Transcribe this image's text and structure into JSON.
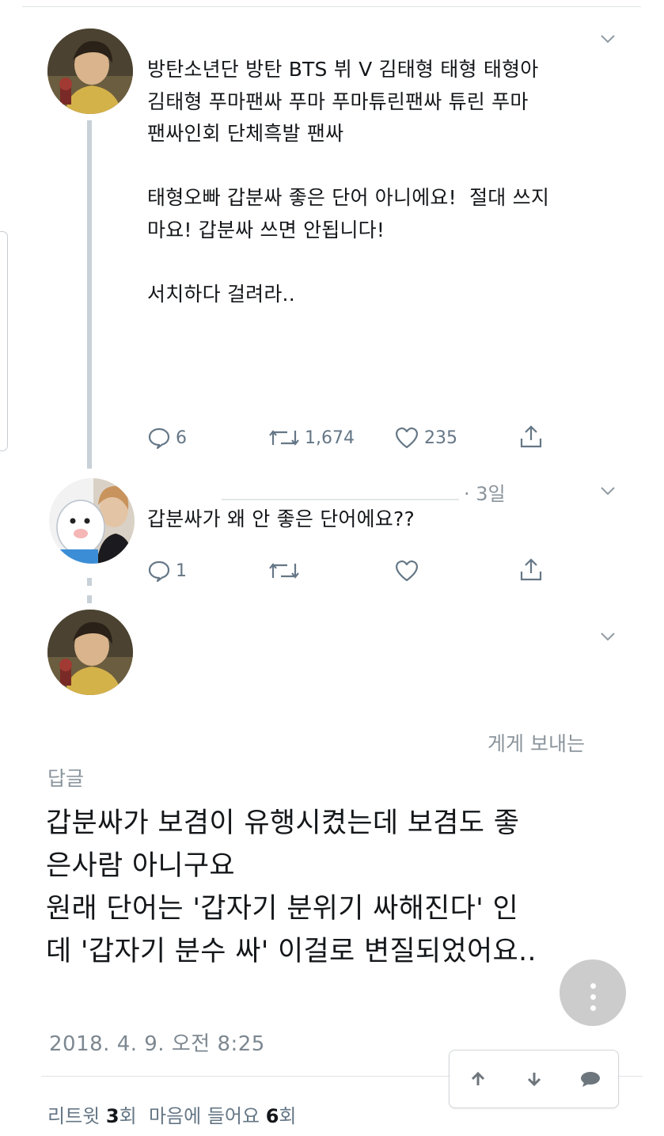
{
  "tweet1": {
    "text": "방탄소년단 방탄 BTS 뷔 V 김태형 태형 태형아\n김태형 푸마팬싸 푸마 푸마튜린팬싸 튜린 푸마\n팬싸인회 단체흑발 팬싸\n\n태형오빠 갑분싸 좋은 단어 아니에요!  절대 쓰지\n마요! 갑분싸 쓰면 안됩니다!\n\n서치하다 걸려라..",
    "replies": "6",
    "retweets": "1,674",
    "likes": "235"
  },
  "tweet2": {
    "time": "· 3일",
    "text": "갑분싸가 왜 안 좋은 단어에요??",
    "replies": "1"
  },
  "tweet3": {
    "partial_line": "게게 보내는",
    "reply_label": "답글",
    "text_lines": [
      "갑분싸가 보겸이 유행시켰는데 보겸도 좋",
      "은사람 아니구요",
      "원래 단어는 '갑자기 분위기 싸해진다' 인",
      "데 '갑자기 분수 싸' 이걸로 변질되었어요.."
    ],
    "date": "2018. 4. 9. 오전 8:25",
    "stats": {
      "retweet_label": "리트윗",
      "retweet_count": "3",
      "retweet_unit": "회",
      "like_label": "마음에 들어요",
      "like_count": "6",
      "like_unit": "회"
    }
  },
  "icons": {
    "reply": "reply-icon",
    "retweet": "retweet-icon",
    "like": "heart-icon",
    "share": "share-icon",
    "chevron": "chevron-down-icon",
    "nav_up": "arrow-up-icon",
    "nav_down": "arrow-down-icon",
    "nav_comment": "comment-icon"
  },
  "colors": {
    "text": "#14171a",
    "gray": "#657786",
    "thread_line": "#c8d1d8",
    "divider": "#dfe3e6"
  }
}
